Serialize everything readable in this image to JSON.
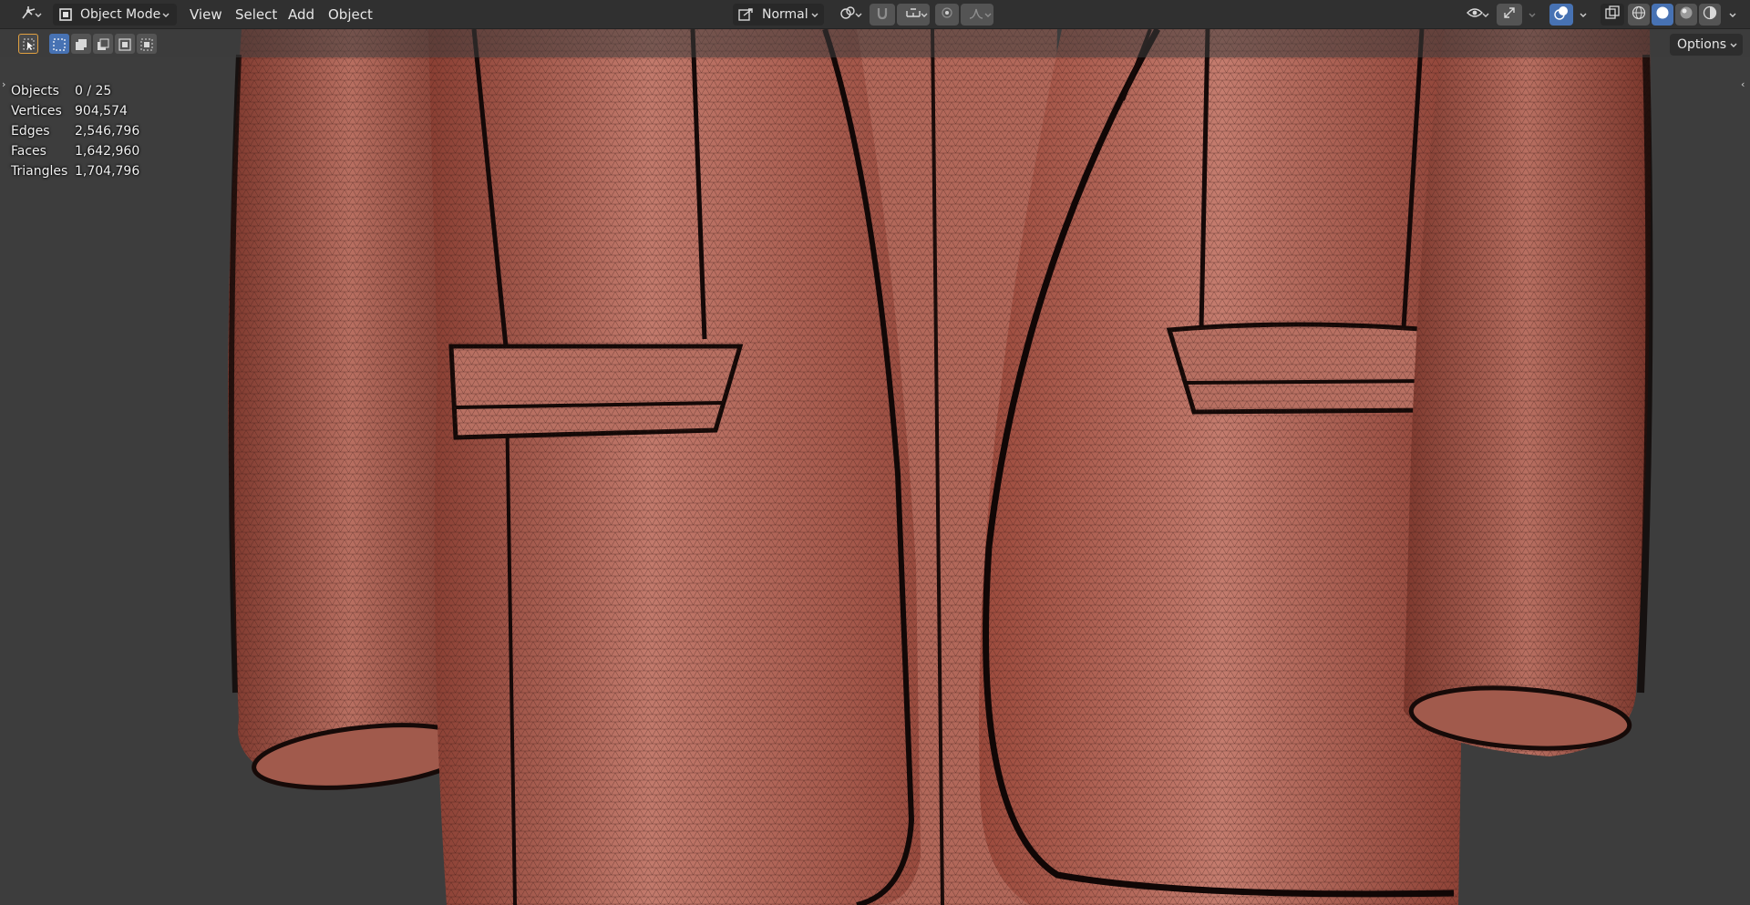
{
  "header": {
    "mode_label": "Object Mode",
    "menus": [
      "View",
      "Select",
      "Add",
      "Object"
    ],
    "orientation_label": "Normal",
    "options_label": "Options"
  },
  "stats": [
    {
      "label": "Objects",
      "value": "0 / 25"
    },
    {
      "label": "Vertices",
      "value": "904,574"
    },
    {
      "label": "Edges",
      "value": "2,546,796"
    },
    {
      "label": "Faces",
      "value": "1,642,960"
    },
    {
      "label": "Triangles",
      "value": "1,704,796"
    }
  ],
  "icons": {
    "editor_type": "editor-type-icon",
    "mode": "object-mode-icon",
    "orientation": "transform-orientation-icon",
    "pivot": "pivot-point-icon",
    "snap": "snap-icon",
    "snap_target": "snap-increment-icon",
    "proportional": "proportional-editing-icon",
    "falloff": "falloff-curve-icon",
    "visibility": "visibility-eye-icon",
    "gizmo": "gizmo-icon",
    "overlays": "overlays-icon",
    "xray": "xray-icon",
    "shading_wire": "wireframe-shading-icon",
    "shading_solid": "solid-shading-icon",
    "shading_material": "material-preview-icon",
    "shading_rendered": "rendered-shading-icon",
    "select_tool": "select-box-tool-icon"
  },
  "colors": {
    "header_bg": "#303030",
    "active_blue": "#4772b3",
    "fabric": "#b05a4c",
    "viewport_bg": "#3d3d3d"
  }
}
